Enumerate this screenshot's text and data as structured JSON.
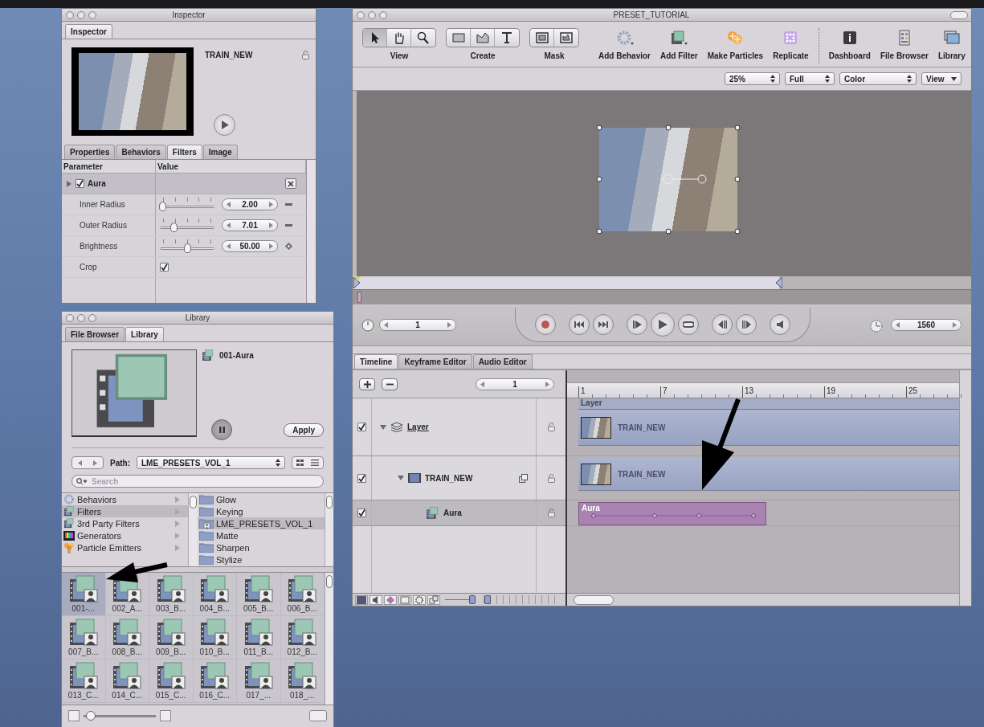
{
  "inspector": {
    "title": "Inspector",
    "tab": "Inspector",
    "clip_name": "TRAIN_NEW",
    "tabs": [
      {
        "label": "Properties",
        "selected": false
      },
      {
        "label": "Behaviors",
        "selected": false
      },
      {
        "label": "Filters",
        "selected": true
      },
      {
        "label": "Image",
        "selected": false
      }
    ],
    "columns": [
      "Parameter",
      "Value"
    ],
    "filter": {
      "name": "Aura",
      "enabled": true,
      "expanded": false
    },
    "params": [
      {
        "kind": "slider",
        "label": "Inner Radius",
        "level": 0.05,
        "value": "2.00",
        "keyframed": false
      },
      {
        "kind": "slider",
        "label": "Outer Radius",
        "level": 0.25,
        "value": "7.01",
        "keyframed": false
      },
      {
        "kind": "slider",
        "label": "Brightness",
        "level": 0.5,
        "value": "50.00",
        "keyframed": true
      },
      {
        "kind": "checkbox",
        "label": "Crop",
        "checked": true
      }
    ]
  },
  "library": {
    "title": "Library",
    "tabs": [
      {
        "label": "File Browser",
        "selected": false
      },
      {
        "label": "Library",
        "selected": true
      }
    ],
    "preview_name": "001-Aura",
    "apply": "Apply",
    "path_label": "Path:",
    "path": "LME_PRESETS_VOL_1",
    "search_placeholder": "Search",
    "categories": [
      {
        "kind": "behaviors",
        "label": "Behaviors",
        "selected": false
      },
      {
        "kind": "filters",
        "label": "Filters",
        "selected": true
      },
      {
        "kind": "filters",
        "label": "3rd Party Filters",
        "selected": false
      },
      {
        "kind": "generators",
        "label": "Generators",
        "selected": false
      },
      {
        "kind": "particles",
        "label": "Particle Emitters",
        "selected": false
      }
    ],
    "folders": [
      {
        "kind": "folder",
        "label": "Glow",
        "selected": false
      },
      {
        "kind": "folder",
        "label": "Keying",
        "selected": false
      },
      {
        "kind": "preset",
        "label": "LME_PRESETS_VOL_1",
        "selected": true
      },
      {
        "kind": "folder",
        "label": "Matte",
        "selected": false
      },
      {
        "kind": "folder",
        "label": "Sharpen",
        "selected": false
      },
      {
        "kind": "folder",
        "label": "Stylize",
        "selected": false
      }
    ],
    "size_slider": {
      "level": 0.05
    },
    "items": [
      {
        "label": "001-...",
        "selected": true
      },
      {
        "label": "002_A...",
        "selected": false
      },
      {
        "label": "003_B...",
        "selected": false
      },
      {
        "label": "004_B...",
        "selected": false
      },
      {
        "label": "005_B...",
        "selected": false
      },
      {
        "label": "006_B...",
        "selected": false
      },
      {
        "label": "007_B...",
        "selected": false
      },
      {
        "label": "008_B...",
        "selected": false
      },
      {
        "label": "009_B...",
        "selected": false
      },
      {
        "label": "010_B...",
        "selected": false
      },
      {
        "label": "011_B...",
        "selected": false
      },
      {
        "label": "012_B...",
        "selected": false
      },
      {
        "label": "013_C...",
        "selected": false
      },
      {
        "label": "014_C...",
        "selected": false
      },
      {
        "label": "015_C...",
        "selected": false
      },
      {
        "label": "016_C...",
        "selected": false
      },
      {
        "label": "017_...",
        "selected": false
      },
      {
        "label": "018_...",
        "selected": false
      }
    ]
  },
  "canvas": {
    "title": "PRESET_TUTORIAL",
    "tool_groups": [
      {
        "label": "View",
        "tools": [
          {
            "kind": "select",
            "selected": true
          },
          {
            "kind": "pan",
            "selected": false
          },
          {
            "kind": "zoom",
            "selected": false
          }
        ]
      },
      {
        "label": "Create",
        "tools": [
          {
            "kind": "rect",
            "selected": false
          },
          {
            "kind": "bezier",
            "selected": false
          },
          {
            "kind": "text",
            "selected": false
          }
        ]
      },
      {
        "label": "Mask",
        "tools": [
          {
            "kind": "rectmask",
            "selected": false
          },
          {
            "kind": "bezmask",
            "selected": false
          }
        ]
      }
    ],
    "buttons": [
      {
        "kind": "behavior",
        "label": "Add Behavior"
      },
      {
        "kind": "filter",
        "label": "Add Filter"
      },
      {
        "kind": "particles",
        "label": "Make Particles"
      },
      {
        "kind": "replicate",
        "label": "Replicate"
      },
      {
        "kind": "dashboard",
        "label": "Dashboard"
      },
      {
        "kind": "browser",
        "label": "File Browser"
      },
      {
        "kind": "library",
        "label": "Library"
      }
    ],
    "popups": [
      {
        "kind": "popup",
        "label": "25%"
      },
      {
        "kind": "popup",
        "label": "Full"
      },
      {
        "kind": "popup",
        "label": "Color"
      },
      {
        "kind": "menu",
        "label": "View"
      }
    ],
    "start_frame": "1",
    "end_frame": "1560"
  },
  "timeline": {
    "tabs": [
      {
        "label": "Timeline",
        "selected": true
      },
      {
        "label": "Keyframe Editor",
        "selected": false
      },
      {
        "label": "Audio Editor",
        "selected": false
      }
    ],
    "zoom_value": "1",
    "track_height_slider": {
      "level": 0.9
    },
    "zoom_slider": {
      "level": 0.05
    },
    "ruler": [
      "1",
      "7",
      "13",
      "19",
      "25"
    ],
    "layers": [
      {
        "kind": "group",
        "name": "Layer",
        "checked": true,
        "expanded": true,
        "selected": false,
        "track_header": "Layer",
        "clip": "TRAIN_NEW",
        "children": [
          {
            "kind": "object",
            "name": "TRAIN_NEW",
            "checked": true,
            "expanded": true,
            "selected": false,
            "clip": "TRAIN_NEW",
            "children": [
              {
                "kind": "filter",
                "name": "Aura",
                "checked": true,
                "selected": true,
                "clip": "Aura"
              }
            ]
          }
        ]
      }
    ]
  }
}
